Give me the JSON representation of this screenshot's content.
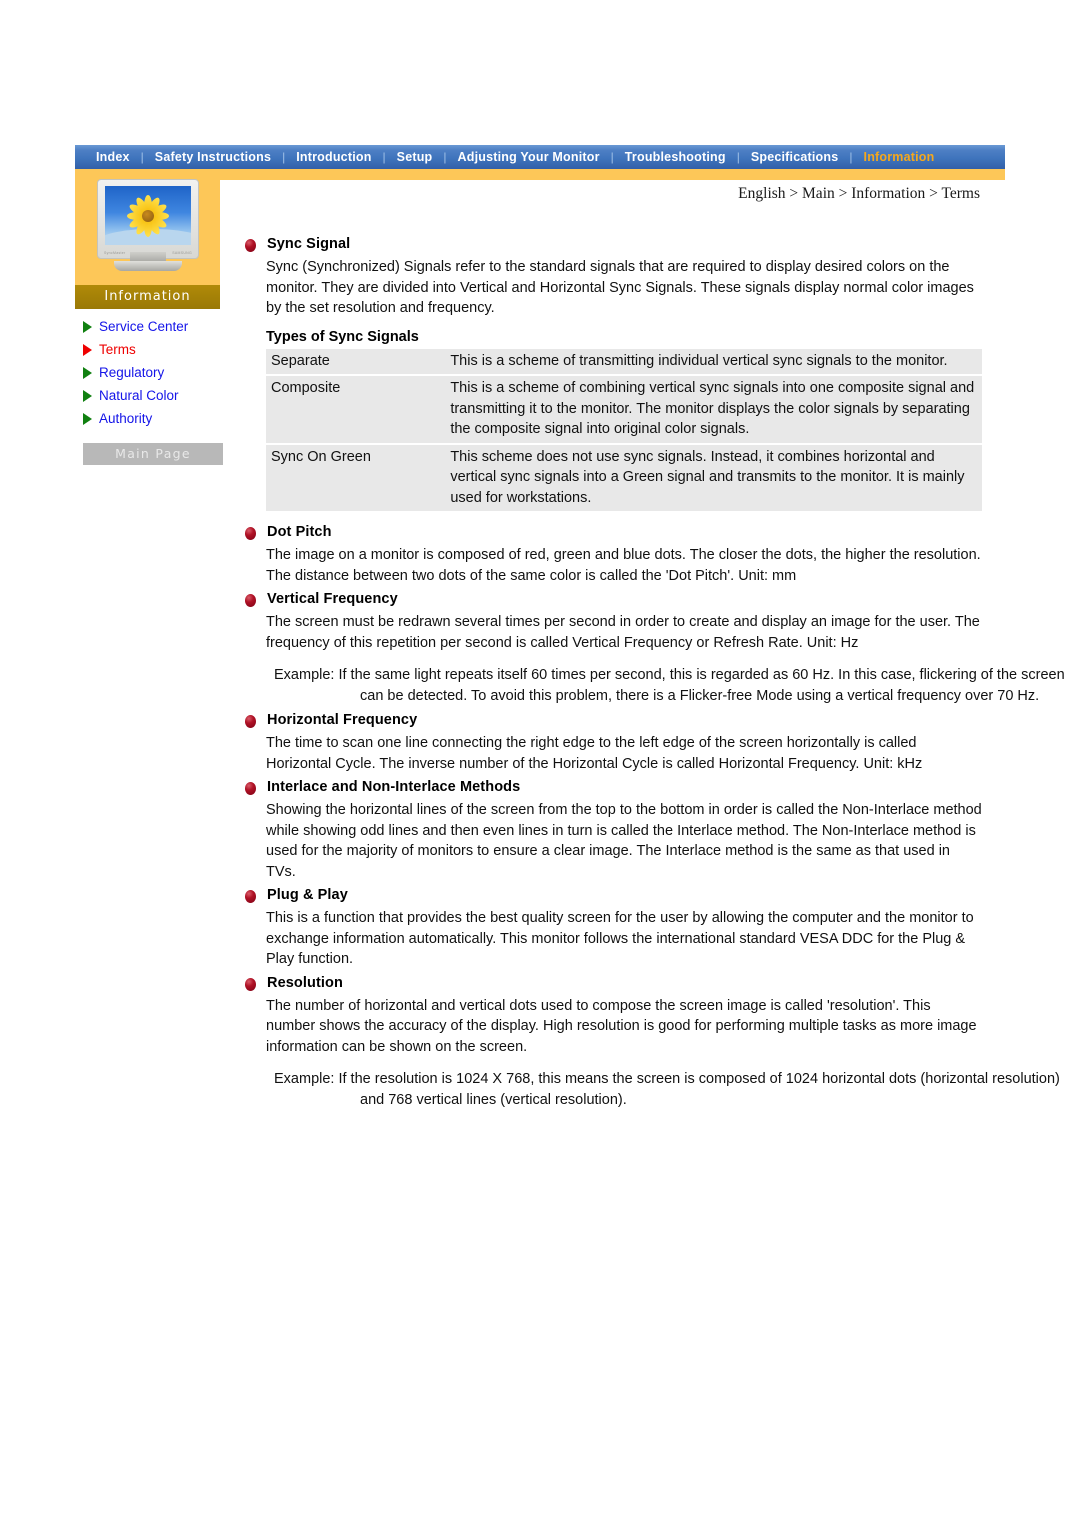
{
  "nav": {
    "items": [
      {
        "label": "Index",
        "active": false
      },
      {
        "label": "Safety Instructions",
        "active": false
      },
      {
        "label": "Introduction",
        "active": false
      },
      {
        "label": "Setup",
        "active": false
      },
      {
        "label": "Adjusting Your Monitor",
        "active": false
      },
      {
        "label": "Troubleshooting",
        "active": false
      },
      {
        "label": "Specifications",
        "active": false
      },
      {
        "label": "Information",
        "active": true
      }
    ],
    "separator": "|",
    "active_color": "#f5a81c",
    "bar_color": "#3f74bd"
  },
  "sidebar": {
    "banner_label": "Information",
    "monitor_brand_left": "SyncMaster",
    "monitor_brand_right": "SAMSUNG",
    "items": [
      {
        "label": "Service Center",
        "current": false
      },
      {
        "label": "Terms",
        "current": true
      },
      {
        "label": "Regulatory",
        "current": false
      },
      {
        "label": "Natural Color",
        "current": false
      },
      {
        "label": "Authority",
        "current": false
      }
    ],
    "main_page_label": "Main Page",
    "accent_orange": "#fdc758",
    "banner_gold": "#9a7906",
    "link_blue": "#1414e8",
    "current_red": "#ee0000"
  },
  "breadcrumb": "English > Main > Information > Terms",
  "sections": [
    {
      "title": "Sync Signal",
      "paragraphs": [
        "Sync (Synchronized) Signals refer to the standard signals that are required to display desired colors on the monitor. They are divided into Vertical and Horizontal Sync Signals. These signals display normal color images by the set resolution and frequency."
      ]
    },
    {
      "title": "Dot Pitch",
      "paragraphs": [
        "The image on a monitor is composed of red, green and blue dots. The closer the dots, the higher the resolution. The distance between two dots of the same color is called the 'Dot Pitch'. Unit: mm"
      ]
    },
    {
      "title": "Vertical Frequency",
      "paragraphs": [
        "The screen must be redrawn several times per second in order to create and display an image for the user. The frequency of this repetition per second is called Vertical Frequency or Refresh Rate. Unit: Hz"
      ],
      "example": "Example: If the same light repeats itself 60 times per second, this is regarded as 60 Hz. In this case, flickering of the screen can be detected. To avoid this problem, there is a Flicker-free Mode using a vertical frequency over 70 Hz."
    },
    {
      "title": "Horizontal Frequency",
      "paragraphs": [
        "The time to scan one line connecting the right edge to the left edge of the screen horizontally is called Horizontal Cycle. The inverse number of the Horizontal Cycle is called Horizontal Frequency. Unit: kHz"
      ]
    },
    {
      "title": "Interlace and Non-Interlace Methods",
      "paragraphs": [
        "Showing the horizontal lines of the screen from the top to the bottom in order is called the Non-Interlace method while showing odd lines and then even lines in turn is called the Interlace method. The Non-Interlace method is used for the majority of monitors to ensure a clear image. The Interlace method is the same as that used in TVs."
      ]
    },
    {
      "title": "Plug & Play",
      "paragraphs": [
        "This is a function that provides the best quality screen for the user by allowing the computer and the monitor to exchange information automatically. This monitor follows the international standard VESA DDC for the Plug & Play function."
      ]
    },
    {
      "title": "Resolution",
      "paragraphs": [
        "The number of horizontal and vertical dots used to compose the screen image is called 'resolution'. This number shows the accuracy of the display. High resolution is good for performing multiple tasks as more image information can be shown on the screen."
      ],
      "example": "Example: If the resolution is 1024 X 768, this means the screen is composed of 1024 horizontal dots (horizontal resolution) and 768 vertical lines (vertical resolution)."
    }
  ],
  "sync_table": {
    "heading": "Types of Sync Signals",
    "rows": [
      {
        "name": "Separate",
        "desc": "This is a scheme of transmitting individual vertical sync signals to the monitor."
      },
      {
        "name": "Composite",
        "desc": "This is a scheme of combining vertical sync signals into one composite signal and transmitting it to the monitor. The monitor displays the color signals by separating the composite signal into original color signals."
      },
      {
        "name": "Sync On Green",
        "desc": "This scheme does not use sync signals. Instead, it combines horizontal and vertical sync signals into a Green signal and transmits to the monitor. It is mainly used for workstations."
      }
    ],
    "row_bg": "#e8e8e8"
  }
}
